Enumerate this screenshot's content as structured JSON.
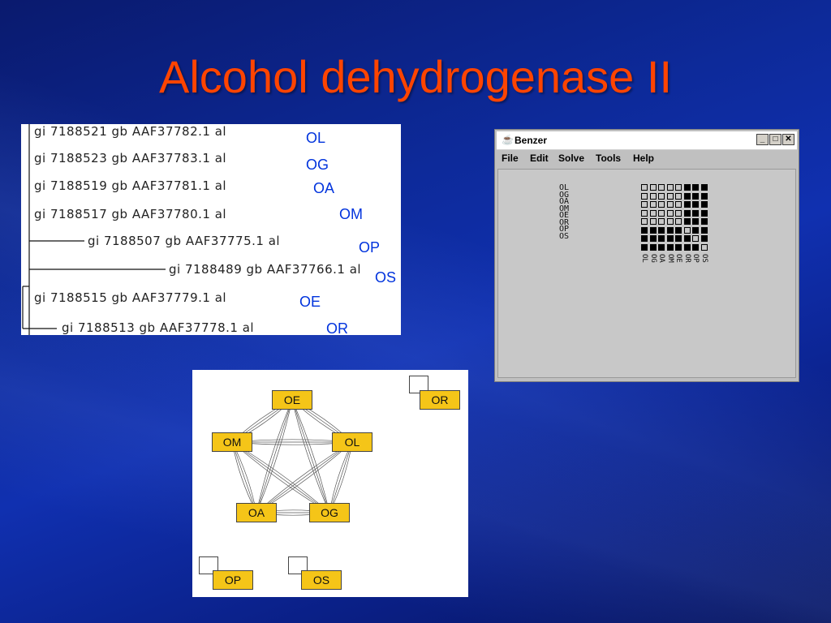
{
  "slide": {
    "title": "Alcohol dehydrogenase II"
  },
  "tree": {
    "leaves": [
      {
        "label": "gi 7188521 gb AAF37782.1  al",
        "code": "OL"
      },
      {
        "label": "gi 7188523 gb AAF37783.1  al",
        "code": "OG"
      },
      {
        "label": "gi 7188519 gb AAF37781.1  al",
        "code": "OA"
      },
      {
        "label": "gi 7188517 gb AAF37780.1  al",
        "code": "OM"
      },
      {
        "label": "gi 7188507 gb AAF37775.1  al",
        "code": "OP"
      },
      {
        "label": "gi 7188489 gb AAF37766.1  al",
        "code": "OS"
      },
      {
        "label": "gi 7188515 gb AAF37779.1  al",
        "code": "OE"
      },
      {
        "label": "gi 7188513 gb AAF37778.1  al",
        "code": "OR"
      }
    ]
  },
  "benzer": {
    "title": "Benzer",
    "icon": "java-cup-icon",
    "window_buttons": {
      "minimize": "_",
      "maximize": "□",
      "close": "✕"
    },
    "menu": [
      "File",
      "Edit",
      "Solve",
      "Tools",
      "Help"
    ],
    "rows": [
      "OL",
      "OG",
      "OA",
      "OM",
      "OE",
      "OR",
      "OP",
      "OS"
    ],
    "cols": [
      "OL",
      "OG",
      "OA",
      "OM",
      "OE",
      "OR",
      "OP",
      "OS"
    ],
    "matrix": [
      [
        0,
        0,
        0,
        0,
        0,
        1,
        1,
        1
      ],
      [
        0,
        0,
        0,
        0,
        0,
        1,
        1,
        1
      ],
      [
        0,
        0,
        0,
        0,
        0,
        1,
        1,
        1
      ],
      [
        0,
        0,
        0,
        0,
        0,
        1,
        1,
        1
      ],
      [
        0,
        0,
        0,
        0,
        0,
        1,
        1,
        1
      ],
      [
        1,
        1,
        1,
        1,
        1,
        0,
        1,
        1
      ],
      [
        1,
        1,
        1,
        1,
        1,
        1,
        0,
        1
      ],
      [
        1,
        1,
        1,
        1,
        1,
        1,
        1,
        0
      ]
    ]
  },
  "graph": {
    "nodes": [
      "OE",
      "OM",
      "OL",
      "OA",
      "OG",
      "OR",
      "OP",
      "OS"
    ],
    "node_color": "#f5c518"
  }
}
